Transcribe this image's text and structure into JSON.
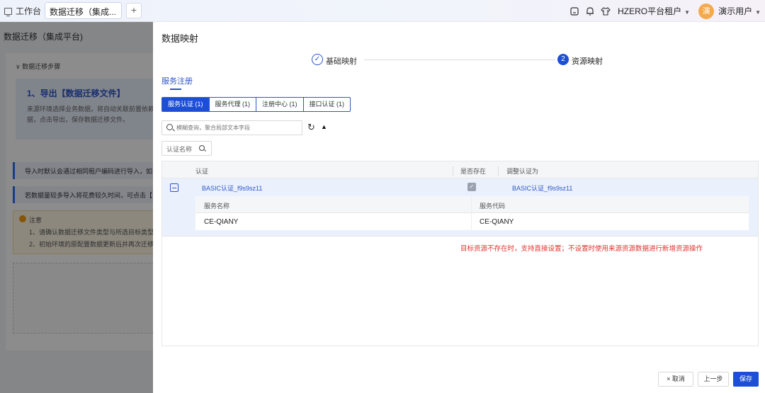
{
  "topbar": {
    "workbench_label": "工作台",
    "active_tab": "数据迁移（集成...",
    "add_tab": "+",
    "tenant": "HZERO平台租户",
    "avatar_text": "演",
    "user": "演示用户",
    "icons": [
      "home-icon",
      "bell-icon",
      "shirt-icon"
    ]
  },
  "background_page": {
    "title": "数据迁移（集成平台)",
    "steps_header": "数据迁移步骤",
    "step1_title": "1、导出【数据迁移文件】",
    "step1_desc": "来源环境选择业务数据，将自动关联前置依赖数据，点击导出，保存数据迁移文件。",
    "info1": "导入时默认会通过相同租户编码进行导入，如",
    "info2": "若数据量较多导入将花费较久时间，可点击【",
    "note_title": "注意",
    "note1": "1、请确认数据迁移文件类型与所选目标类型一",
    "note2": "2、初始环境的原配置数据更新后并再次迁移，"
  },
  "drawer": {
    "title": "数据映射",
    "steps": [
      {
        "label": "基础映射",
        "status": "done"
      },
      {
        "label": "资源映射",
        "number": "2",
        "status": "active"
      }
    ],
    "section_tab": "服务注册",
    "segments": [
      "服务认证 (1)",
      "服务代理 (1)",
      "注册中心 (1)",
      "接口认证 (1)"
    ],
    "search_placeholder": "模糊查询，聚合局部文本字段",
    "filter_label": "认证名称",
    "table": {
      "headers": [
        "认证",
        "是否存在",
        "调整认证为"
      ],
      "row": {
        "auth": "BASIC认证_f9s9sz11",
        "exists": true,
        "adjust_to": "BASIC认证_f9s9sz11"
      },
      "sub_headers": [
        "服务名称",
        "服务代码"
      ],
      "sub_row": [
        "CE-QIANY",
        "CE-QIANY"
      ]
    },
    "hint": "目标资源不存在时，支持直接设置；不设置时使用来源资源数据进行新增资源操作",
    "buttons": {
      "cancel": "取消",
      "cancel_icon": "×",
      "prev": "上一步",
      "save": "保存"
    }
  },
  "colors": {
    "accent": "#1d4fd6",
    "hint_red": "#e0322c",
    "avatar": "#f6a94c"
  }
}
